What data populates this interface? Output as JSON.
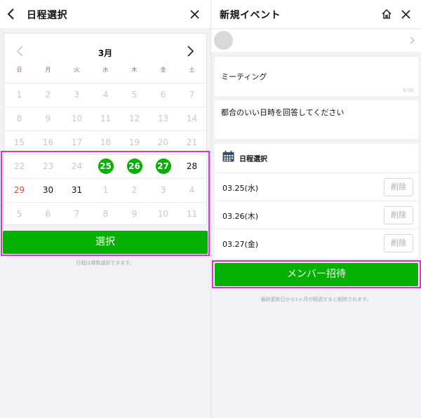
{
  "left": {
    "title": "日程選択",
    "month": "3月",
    "weekdays": [
      "日",
      "月",
      "火",
      "水",
      "木",
      "金",
      "土"
    ],
    "rows": [
      [
        "1",
        "2",
        "3",
        "4",
        "5",
        "6",
        "7"
      ],
      [
        "8",
        "9",
        "10",
        "11",
        "12",
        "13",
        "14"
      ],
      [
        "15",
        "16",
        "17",
        "18",
        "19",
        "20",
        "21"
      ],
      [
        "22",
        "23",
        "24",
        "25",
        "26",
        "27",
        "28"
      ],
      [
        "29",
        "30",
        "31",
        "1",
        "2",
        "3",
        "4"
      ],
      [
        "5",
        "6",
        "7",
        "8",
        "9",
        "10",
        "11"
      ]
    ],
    "selected_days": [
      "25",
      "26",
      "27"
    ],
    "select_button": "選択",
    "note": "日程は複数選択できます。"
  },
  "right": {
    "title": "新規イベント",
    "event_name": "ミーティング",
    "event_name_counter": "6/30",
    "description": "都合のいい日時を回答してください",
    "description_counter": ".",
    "section_title": "日程選択",
    "dates": [
      {
        "date": "03.25(水)",
        "delete": "削除"
      },
      {
        "date": "03.26(木)",
        "delete": "削除"
      },
      {
        "date": "03.27(金)",
        "delete": "削除"
      }
    ],
    "invite_button": "メンバー招待",
    "note": "最終更新日から1ヶ月が経過すると削除されます。"
  },
  "colors": {
    "accent": "#06b000",
    "highlight": "#e52fc9",
    "sunday": "#e0472a"
  }
}
